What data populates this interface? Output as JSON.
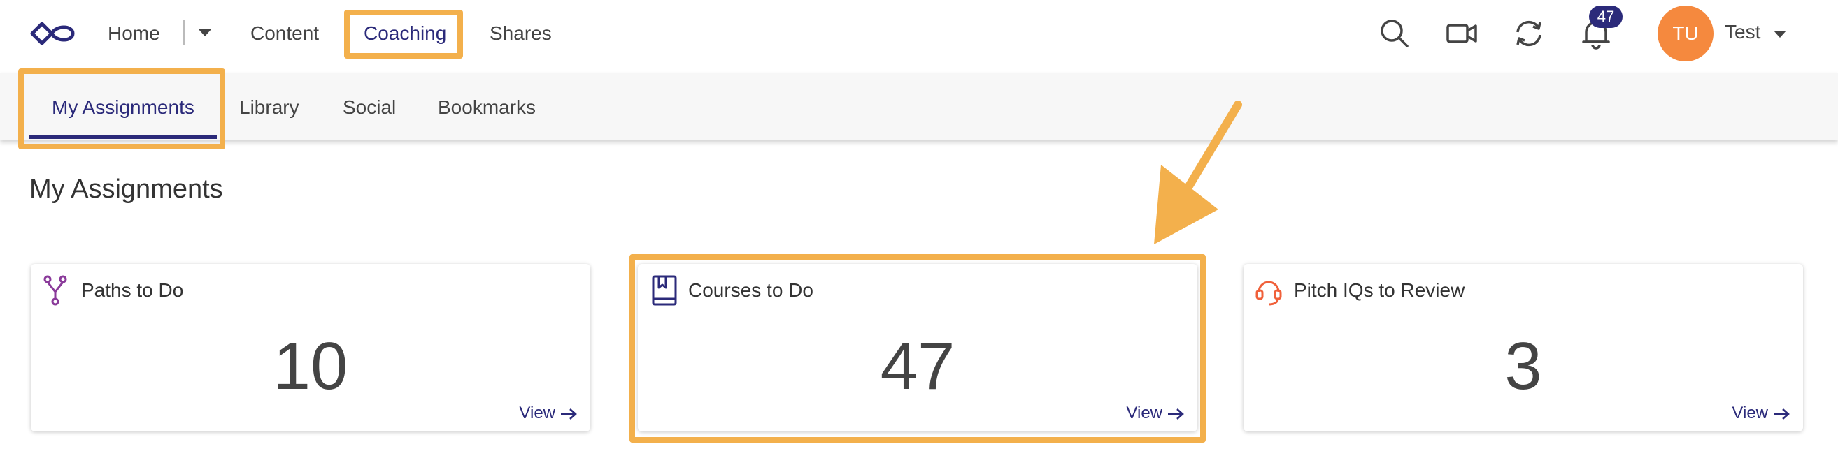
{
  "nav": {
    "items": [
      {
        "label": "Home"
      },
      {
        "label": "Content"
      },
      {
        "label": "Coaching"
      },
      {
        "label": "Shares"
      }
    ]
  },
  "header": {
    "notification_count": "47",
    "avatar_initials": "TU",
    "user_name": "Test",
    "icons": [
      "search-icon",
      "video-camera-icon",
      "sync-icon",
      "bell-icon"
    ]
  },
  "subnav": {
    "tabs": [
      {
        "label": "My Assignments",
        "active": true
      },
      {
        "label": "Library"
      },
      {
        "label": "Social"
      },
      {
        "label": "Bookmarks"
      }
    ]
  },
  "page": {
    "title": "My Assignments"
  },
  "cards": [
    {
      "title": "Paths to Do",
      "count": "10",
      "view_label": "View",
      "icon": "path-fork-icon"
    },
    {
      "title": "Courses to Do",
      "count": "47",
      "view_label": "View",
      "icon": "book-icon"
    },
    {
      "title": "Pitch IQs to Review",
      "count": "3",
      "view_label": "View",
      "icon": "headset-icon"
    }
  ],
  "colors": {
    "brand": "#2b2a7a",
    "highlight": "#f3b04c",
    "avatar": "#f5893e",
    "paths_icon": "#8a3a9a",
    "pitch_icon": "#f0603a"
  }
}
